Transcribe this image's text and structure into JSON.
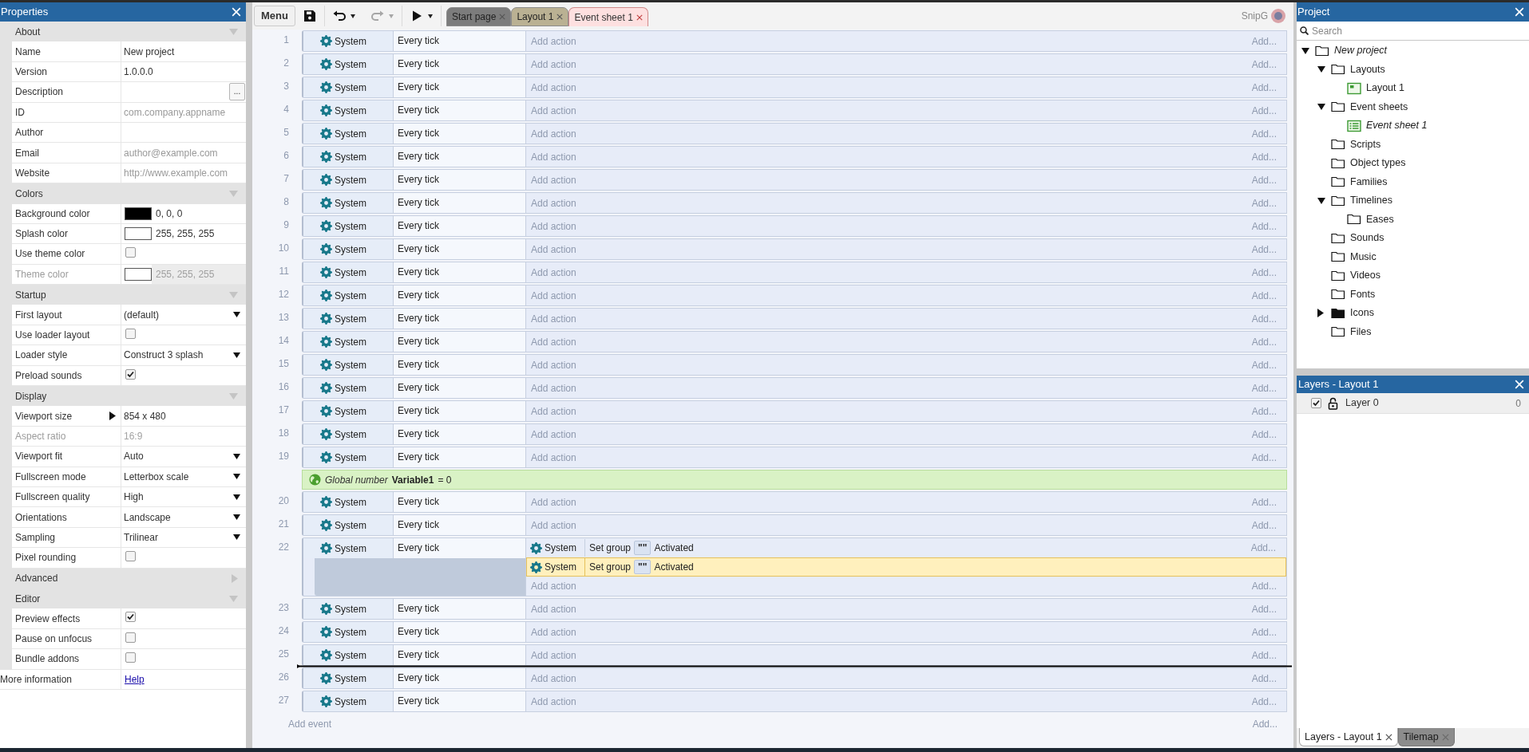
{
  "properties": {
    "title": "Properties",
    "sections": [
      {
        "title": "About",
        "expanded": true,
        "rows": [
          {
            "label": "Name",
            "kind": "field",
            "value": "New project",
            "disabled": false
          },
          {
            "label": "Version",
            "kind": "field",
            "value": "1.0.0.0",
            "disabled": false
          },
          {
            "label": "Description",
            "kind": "field",
            "button": "...",
            "disabled": false
          },
          {
            "label": "ID",
            "kind": "field",
            "placeholder": "com.company.appname",
            "disabled": false
          },
          {
            "label": "Author",
            "kind": "field",
            "disabled": false
          },
          {
            "label": "Email",
            "kind": "field",
            "placeholder": "author@example.com",
            "disabled": false
          },
          {
            "label": "Website",
            "kind": "field",
            "placeholder": "http://www.example.com",
            "disabled": false
          }
        ]
      },
      {
        "title": "Colors",
        "expanded": true,
        "rows": [
          {
            "label": "Background color",
            "kind": "color",
            "color": "#000000",
            "value": "0, 0, 0",
            "disabled": false
          },
          {
            "label": "Splash color",
            "kind": "color",
            "color": "#ffffff",
            "value": "255, 255, 255",
            "disabled": false
          },
          {
            "label": "Use theme color",
            "kind": "checkbox",
            "checked": false,
            "disabled": false
          },
          {
            "label": "Theme color",
            "kind": "color",
            "color": "#ffffff",
            "value": "255, 255, 255",
            "disabled": true
          }
        ]
      },
      {
        "title": "Startup",
        "expanded": true,
        "rows": [
          {
            "label": "First layout",
            "kind": "dropdown",
            "value": "(default)",
            "disabled": false
          },
          {
            "label": "Use loader layout",
            "kind": "checkbox",
            "checked": false,
            "disabled": false
          },
          {
            "label": "Loader style",
            "kind": "dropdown",
            "value": "Construct 3 splash",
            "disabled": false
          },
          {
            "label": "Preload sounds",
            "kind": "checkbox",
            "checked": true,
            "disabled": false
          }
        ]
      },
      {
        "title": "Display",
        "expanded": true,
        "rows": [
          {
            "label": "Viewport size",
            "kind": "expander",
            "expanded": false,
            "value": "854 x 480",
            "disabled": false
          },
          {
            "label": "Aspect ratio",
            "kind": "text",
            "value": "16:9",
            "disabled": true
          },
          {
            "label": "Viewport fit",
            "kind": "dropdown",
            "value": "Auto",
            "disabled": false
          },
          {
            "label": "Fullscreen mode",
            "kind": "dropdown",
            "value": "Letterbox scale",
            "disabled": false
          },
          {
            "label": "Fullscreen quality",
            "kind": "dropdown",
            "value": "High",
            "disabled": false
          },
          {
            "label": "Orientations",
            "kind": "dropdown",
            "value": "Landscape",
            "disabled": false
          },
          {
            "label": "Sampling",
            "kind": "dropdown",
            "value": "Trilinear",
            "disabled": false
          },
          {
            "label": "Pixel rounding",
            "kind": "checkbox",
            "checked": false,
            "disabled": false
          }
        ]
      },
      {
        "title": "Advanced",
        "expanded": false
      },
      {
        "title": "Editor",
        "expanded": true,
        "rows": [
          {
            "label": "Preview effects",
            "kind": "checkbox",
            "checked": true,
            "disabled": false
          },
          {
            "label": "Pause on unfocus",
            "kind": "checkbox",
            "checked": false,
            "disabled": false
          },
          {
            "label": "Bundle addons",
            "kind": "checkbox",
            "checked": false,
            "disabled": false
          }
        ]
      }
    ],
    "footer": {
      "label": "More information",
      "link": "Help"
    }
  },
  "toolbar": {
    "menu": "Menu",
    "tools": [
      {
        "kind": "save",
        "disabled": false
      },
      {
        "kind": "divider"
      },
      {
        "kind": "undo",
        "disabled": false,
        "dropdown": true
      },
      {
        "kind": "redo",
        "disabled": true,
        "dropdown": true
      },
      {
        "kind": "divider"
      },
      {
        "kind": "play",
        "disabled": false,
        "dropdown": true
      },
      {
        "kind": "divider"
      }
    ],
    "tabs": [
      {
        "label": "Start page",
        "color": "#7c7c7c",
        "selected": false
      },
      {
        "label": "Layout 1",
        "color": "#bab193",
        "selected": false
      },
      {
        "label": "Event sheet 1",
        "color": "#fde0e0",
        "selected": true
      }
    ],
    "user": "SnipG"
  },
  "events": [
    {
      "kind": "event",
      "number": "1",
      "object": "System",
      "condition": "Every tick",
      "add_action": "Add action",
      "add_more": "Add..."
    },
    {
      "kind": "event",
      "number": "2",
      "object": "System",
      "condition": "Every tick",
      "add_action": "Add action",
      "add_more": "Add..."
    },
    {
      "kind": "event",
      "number": "3",
      "object": "System",
      "condition": "Every tick",
      "add_action": "Add action",
      "add_more": "Add..."
    },
    {
      "kind": "event",
      "number": "4",
      "object": "System",
      "condition": "Every tick",
      "add_action": "Add action",
      "add_more": "Add..."
    },
    {
      "kind": "event",
      "number": "5",
      "object": "System",
      "condition": "Every tick",
      "add_action": "Add action",
      "add_more": "Add..."
    },
    {
      "kind": "event",
      "number": "6",
      "object": "System",
      "condition": "Every tick",
      "add_action": "Add action",
      "add_more": "Add..."
    },
    {
      "kind": "event",
      "number": "7",
      "object": "System",
      "condition": "Every tick",
      "add_action": "Add action",
      "add_more": "Add..."
    },
    {
      "kind": "event",
      "number": "8",
      "object": "System",
      "condition": "Every tick",
      "add_action": "Add action",
      "add_more": "Add..."
    },
    {
      "kind": "event",
      "number": "9",
      "object": "System",
      "condition": "Every tick",
      "add_action": "Add action",
      "add_more": "Add..."
    },
    {
      "kind": "event",
      "number": "10",
      "object": "System",
      "condition": "Every tick",
      "add_action": "Add action",
      "add_more": "Add..."
    },
    {
      "kind": "event",
      "number": "11",
      "object": "System",
      "condition": "Every tick",
      "add_action": "Add action",
      "add_more": "Add..."
    },
    {
      "kind": "event",
      "number": "12",
      "object": "System",
      "condition": "Every tick",
      "add_action": "Add action",
      "add_more": "Add..."
    },
    {
      "kind": "event",
      "number": "13",
      "object": "System",
      "condition": "Every tick",
      "add_action": "Add action",
      "add_more": "Add..."
    },
    {
      "kind": "event",
      "number": "14",
      "object": "System",
      "condition": "Every tick",
      "add_action": "Add action",
      "add_more": "Add..."
    },
    {
      "kind": "event",
      "number": "15",
      "object": "System",
      "condition": "Every tick",
      "add_action": "Add action",
      "add_more": "Add..."
    },
    {
      "kind": "event",
      "number": "16",
      "object": "System",
      "condition": "Every tick",
      "add_action": "Add action",
      "add_more": "Add..."
    },
    {
      "kind": "event",
      "number": "17",
      "object": "System",
      "condition": "Every tick",
      "add_action": "Add action",
      "add_more": "Add..."
    },
    {
      "kind": "event",
      "number": "18",
      "object": "System",
      "condition": "Every tick",
      "add_action": "Add action",
      "add_more": "Add..."
    },
    {
      "kind": "event",
      "number": "19",
      "object": "System",
      "condition": "Every tick",
      "add_action": "Add action",
      "add_more": "Add..."
    },
    {
      "kind": "variable",
      "type": "Global number",
      "name": "Variable1",
      "value": "= 0"
    },
    {
      "kind": "event",
      "number": "20",
      "object": "System",
      "condition": "Every tick",
      "add_action": "Add action",
      "add_more": "Add..."
    },
    {
      "kind": "event",
      "number": "21",
      "object": "System",
      "condition": "Every tick",
      "add_action": "Add action",
      "add_more": "Add..."
    },
    {
      "kind": "event",
      "number": "22",
      "object": "System",
      "condition": "Every tick",
      "actions": [
        {
          "object": "System",
          "verb": "Set group",
          "param": "\"\"",
          "state": "Activated",
          "more": "Add...",
          "selected": false
        },
        {
          "object": "System",
          "verb": "Set group",
          "param": "\"\"",
          "state": "Activated",
          "selected": true
        }
      ],
      "add_action": "Add action",
      "add_more": "Add..."
    },
    {
      "kind": "event",
      "number": "23",
      "object": "System",
      "condition": "Every tick",
      "add_action": "Add action",
      "add_more": "Add..."
    },
    {
      "kind": "event",
      "number": "24",
      "object": "System",
      "condition": "Every tick",
      "add_action": "Add action",
      "add_more": "Add..."
    },
    {
      "kind": "event",
      "number": "25",
      "object": "System",
      "condition": "Every tick",
      "add_action": "Add action",
      "add_more": "Add..."
    },
    {
      "kind": "event",
      "number": "26",
      "object": "System",
      "condition": "Every tick",
      "add_action": "Add action",
      "add_more": "Add...",
      "drop_marker": true
    },
    {
      "kind": "event",
      "number": "27",
      "object": "System",
      "condition": "Every tick",
      "add_action": "Add action",
      "add_more": "Add..."
    }
  ],
  "add_event": {
    "label": "Add event",
    "more": "Add..."
  },
  "project": {
    "title": "Project",
    "search_placeholder": "Search",
    "tree": [
      {
        "label": "New project",
        "kind": "folder",
        "modified": true,
        "expanded": true,
        "children": [
          {
            "label": "Layouts",
            "kind": "folder",
            "modified": false,
            "expanded": true,
            "children": [
              {
                "label": "Layout 1",
                "kind": "layout",
                "modified": false
              }
            ]
          },
          {
            "label": "Event sheets",
            "kind": "folder",
            "modified": false,
            "expanded": true,
            "children": [
              {
                "label": "Event sheet 1",
                "kind": "event-sheet",
                "modified": true
              }
            ]
          },
          {
            "label": "Scripts",
            "kind": "folder",
            "modified": false
          },
          {
            "label": "Object types",
            "kind": "folder",
            "modified": false
          },
          {
            "label": "Families",
            "kind": "folder",
            "modified": false
          },
          {
            "label": "Timelines",
            "kind": "folder",
            "modified": false,
            "expanded": true,
            "children": [
              {
                "label": "Eases",
                "kind": "folder",
                "modified": false
              }
            ]
          },
          {
            "label": "Sounds",
            "kind": "folder",
            "modified": false
          },
          {
            "label": "Music",
            "kind": "folder",
            "modified": false
          },
          {
            "label": "Videos",
            "kind": "folder",
            "modified": false
          },
          {
            "label": "Fonts",
            "kind": "folder",
            "modified": false
          },
          {
            "label": "Icons",
            "kind": "folder-filled",
            "modified": false,
            "expanded": false
          },
          {
            "label": "Files",
            "kind": "folder",
            "modified": false
          }
        ]
      }
    ]
  },
  "layers": {
    "title": "Layers - Layout 1",
    "rows": [
      {
        "visible": true,
        "locked": false,
        "name": "Layer 0",
        "count": "0"
      }
    ]
  },
  "bottom_tabs": [
    {
      "label": "Layers - Layout 1",
      "selected": true
    },
    {
      "label": "Tilemap",
      "selected": false
    }
  ]
}
